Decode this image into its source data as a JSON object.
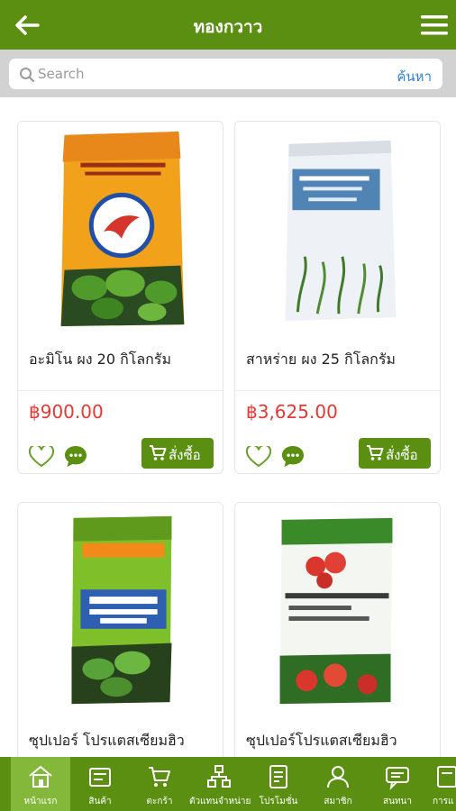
{
  "header": {
    "title": "ทองกวาว",
    "back_icon": "arrow-left-icon",
    "menu_icon": "hamburger-menu-icon"
  },
  "search": {
    "placeholder": "Search",
    "button_label": "ค้นหา"
  },
  "products": [
    {
      "name": "อะมิโน ผง 20 กิโลกรัม",
      "price": "฿900.00",
      "order_label": "สั่งซื้อ",
      "image": "amino-powder-bag"
    },
    {
      "name": "สาหร่าย ผง 25 กิโลกรัม",
      "price": "฿3,625.00",
      "order_label": "สั่งซื้อ",
      "image": "seaweed-extract-powder-bag"
    },
    {
      "name": "ซุปเปอร์ โปรแตสเซียมฮิว",
      "image": "super-potassium-humate-flake-bag"
    },
    {
      "name": "ซุปเปอร์โปรแตสเซียมฮิว",
      "image": "super-potassium-humate-powder-bag"
    }
  ],
  "colors": {
    "brand": "#5a8f12",
    "brand_active": "#83b83a",
    "price": "#e53935",
    "link": "#2f7fd1"
  },
  "bottom_nav": [
    {
      "label": "หน้าแรก",
      "icon": "home-icon",
      "active": true
    },
    {
      "label": "สินค้า",
      "icon": "products-icon"
    },
    {
      "label": "ตะกร้า",
      "icon": "cart-icon"
    },
    {
      "label": "ตัวแทนจำหน่าย",
      "icon": "dealer-network-icon"
    },
    {
      "label": "โปรโมชั่น",
      "icon": "promotion-icon"
    },
    {
      "label": "สมาชิก",
      "icon": "member-icon"
    },
    {
      "label": "สนทนา",
      "icon": "chat-icon"
    },
    {
      "label": "การแ",
      "icon": "settings-icon"
    }
  ]
}
